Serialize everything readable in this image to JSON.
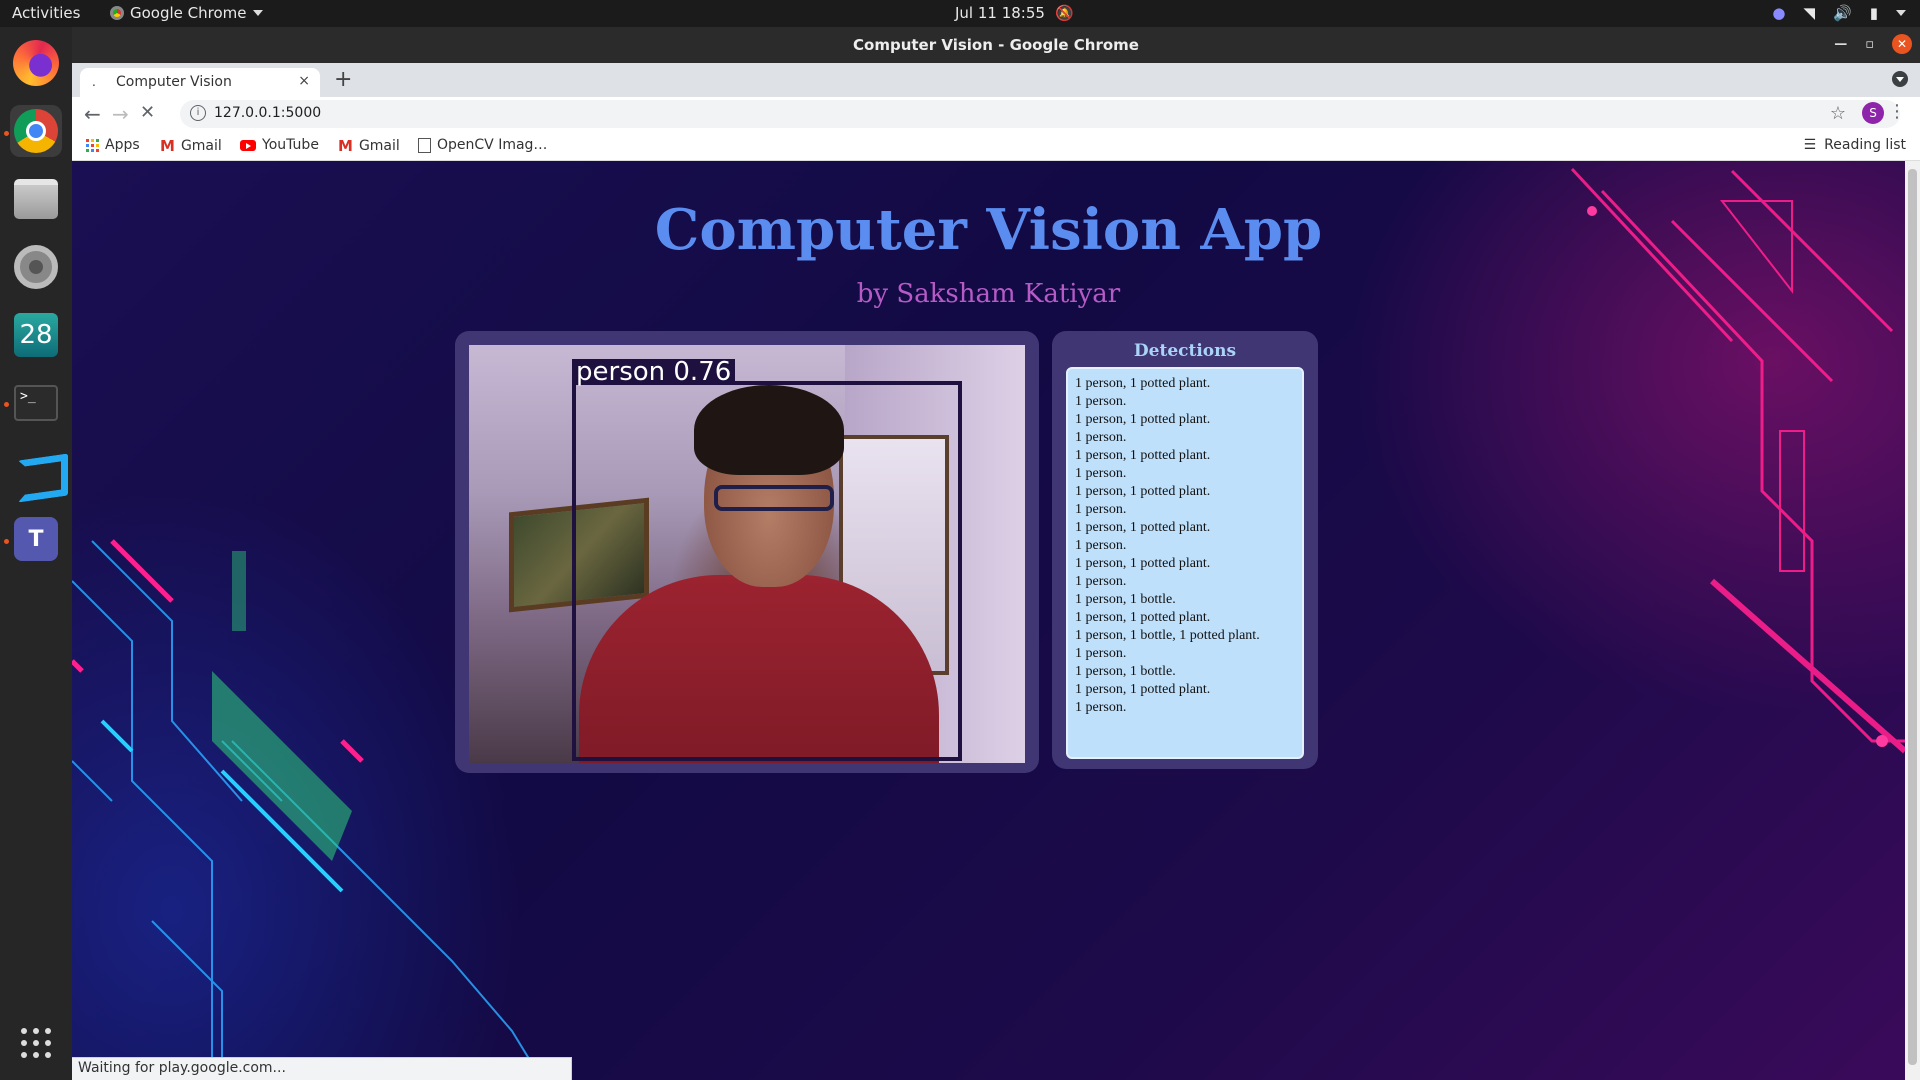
{
  "os": {
    "activities": "Activities",
    "app_menu": "Google Chrome",
    "clock": "Jul 11  18:55",
    "dock_calendar_day": "28"
  },
  "window": {
    "title": "Computer Vision - Google Chrome"
  },
  "tab": {
    "label": "Computer Vision",
    "favicon": ".",
    "close": "×"
  },
  "omnibox": {
    "url": "127.0.0.1:5000",
    "info_icon": "i",
    "avatar_letter": "S"
  },
  "bookmarks": [
    {
      "label": "Apps",
      "icon": "apps-grid-icon"
    },
    {
      "label": "Gmail",
      "icon": "gmail-icon"
    },
    {
      "label": "YouTube",
      "icon": "youtube-icon"
    },
    {
      "label": "Gmail",
      "icon": "gmail-icon"
    },
    {
      "label": "OpenCV Imag…",
      "icon": "document-icon"
    }
  ],
  "reading_list": "Reading list",
  "page": {
    "title": "Computer Vision App",
    "subtitle": "by Saksham Katiyar",
    "video_label": "person 0.76",
    "detections_title": "Detections",
    "detections": [
      "1 person, 1 potted plant.",
      "1 person.",
      "1 person, 1 potted plant.",
      "1 person.",
      "1 person, 1 potted plant.",
      "1 person.",
      "1 person, 1 potted plant.",
      "1 person.",
      "1 person, 1 potted plant.",
      "1 person.",
      "1 person, 1 potted plant.",
      "1 person.",
      "1 person, 1 bottle.",
      "1 person, 1 potted plant.",
      "1 person, 1 bottle, 1 potted plant.",
      "1 person.",
      "1 person, 1 bottle.",
      "1 person, 1 potted plant.",
      "1 person."
    ]
  },
  "status": "Waiting for play.google.com...",
  "colors": {
    "title": "#5b8df0",
    "subtitle": "#b65bc6",
    "card": "#3f3673",
    "list_bg": "#bfe0fb",
    "accent_pink": "#ff1f8e",
    "ubuntu_orange": "#e95420"
  }
}
